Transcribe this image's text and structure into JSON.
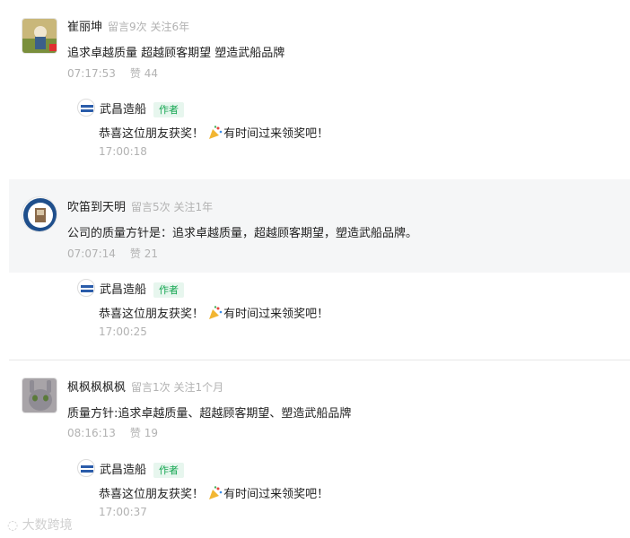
{
  "comments": [
    {
      "name": "崔丽坤",
      "meta": "留言9次 关注6年",
      "text": "追求卓越质量  超越顾客期望  塑造武船品牌",
      "time": "07:17:53",
      "likes": "赞 44",
      "reply": {
        "name": "武昌造船",
        "badge": "作者",
        "text_before": "恭喜这位朋友获奖！",
        "text_after": "有时间过来领奖吧！",
        "time": "17:00:18"
      }
    },
    {
      "name": "吹笛到天明",
      "meta": "留言5次 关注1年",
      "text": "公司的质量方针是：追求卓越质量，超越顾客期望，塑造武船品牌。",
      "time": "07:07:14",
      "likes": "赞 21",
      "reply": {
        "name": "武昌造船",
        "badge": "作者",
        "text_before": "恭喜这位朋友获奖！",
        "text_after": "有时间过来领奖吧！",
        "time": "17:00:25"
      }
    },
    {
      "name": "枫枫枫枫枫",
      "meta": "留言1次 关注1个月",
      "text": "质量方针:追求卓越质量、超越顾客期望、塑造武船品牌",
      "time": "08:16:13",
      "likes": "赞 19",
      "reply": {
        "name": "武昌造船",
        "badge": "作者",
        "text_before": "恭喜这位朋友获奖！",
        "text_after": "有时间过来领奖吧！",
        "time": "17:00:37"
      }
    }
  ],
  "watermark": "大数跨境",
  "colors": {
    "badge_text": "#14a651",
    "badge_bg": "#e7f6ee",
    "highlight_bg": "#f5f6f7"
  }
}
